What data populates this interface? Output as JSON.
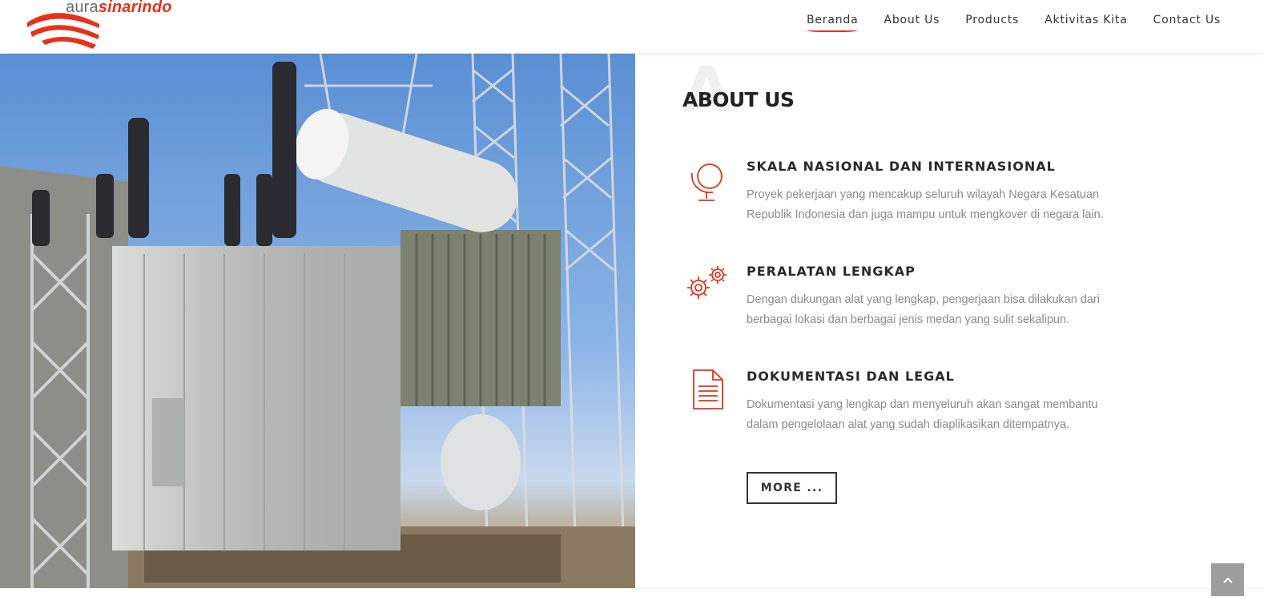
{
  "header": {
    "logo": {
      "part1": "aura",
      "part2": "sinarindo"
    },
    "nav": [
      {
        "label": "Beranda",
        "active": true
      },
      {
        "label": "About Us"
      },
      {
        "label": "Products"
      },
      {
        "label": "Aktivitas Kita"
      },
      {
        "label": "Contact Us"
      }
    ]
  },
  "photo": {
    "icon": "power-transformer-photo"
  },
  "about": {
    "watermark": "A",
    "title": "ABOUT US",
    "features": [
      {
        "icon": "globe-icon",
        "title": "SKALA NASIONAL DAN INTERNASIONAL",
        "text": "Proyek pekerjaan yang mencakup seluruh wilayah Negara Kesatuan Republik Indonesia dan juga mampu untuk mengkover di negara lain."
      },
      {
        "icon": "gears-icon",
        "title": "PERALATAN LENGKAP",
        "text": "Dengan dukungan alat yang lengkap, pengerjaan bisa dilakukan dari berbagai lokasi dan berbagai jenis medan yang sulit sekalipun."
      },
      {
        "icon": "document-icon",
        "title": "DOKUMENTASI DAN LEGAL",
        "text": "Dokumentasi yang lengkap dan menyeluruh akan sangat membantu dalam pengelolaan alat yang sudah diaplikasikan ditempatnya."
      }
    ],
    "more_label": "MORE ..."
  },
  "scroll_top": {
    "icon": "chevron-up-icon"
  },
  "colors": {
    "accent": "#e4321c",
    "text": "#333333",
    "muted": "#8a8a8a"
  }
}
